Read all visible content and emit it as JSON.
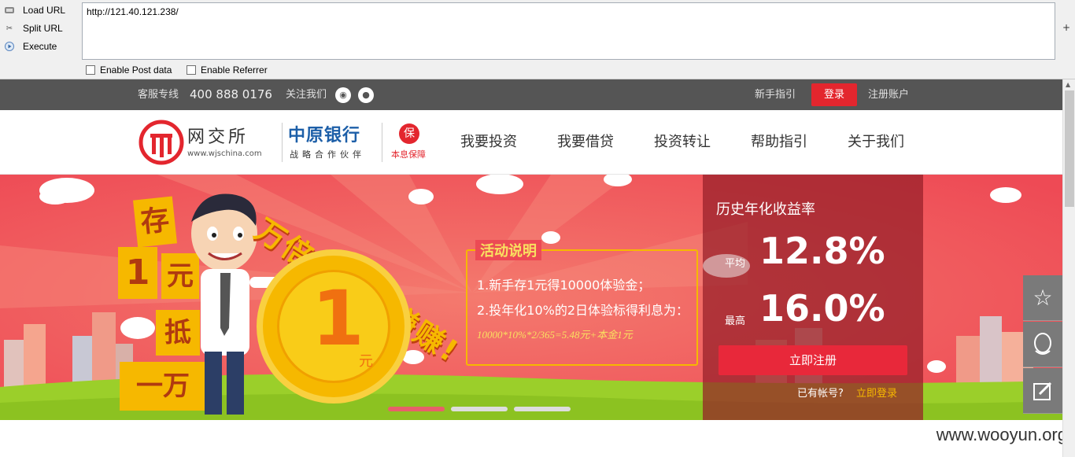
{
  "hackbar": {
    "load_url": "Load URL",
    "split_url": "Split URL",
    "execute": "Execute",
    "url_value": "http://121.40.121.238/",
    "enable_post": "Enable Post data",
    "enable_referrer": "Enable Referrer"
  },
  "topbar": {
    "service_label": "客服专线",
    "phone": "400 888 0176",
    "follow_label": "关注我们",
    "guide": "新手指引",
    "login": "登录",
    "register": "注册账户"
  },
  "nav": {
    "logo_name": "网交所",
    "logo_url": "www.wjschina.com",
    "partner_name": "中原银行",
    "partner_sub": "战略合作伙伴",
    "guarantee_badge": "保",
    "guarantee_text": "本息保障",
    "items": [
      "我要投资",
      "我要借贷",
      "投资转让",
      "帮助指引",
      "关于我们"
    ]
  },
  "banner": {
    "side_chars": [
      "存",
      "1",
      "元",
      "抵",
      "一万"
    ],
    "slogan": "万倍收益赚赚赚!",
    "coin_value": "1",
    "coin_unit": "元",
    "activity_title": "活动说明",
    "activity_line1": "1.新手存1元得10000体验金；",
    "activity_line2": "2.投年化10%的2日体验标得利息为：",
    "activity_formula": "10000*10%*2/365=5.48元+本金1元"
  },
  "panel": {
    "title": "历史年化收益率",
    "avg_label": "平均",
    "avg_value": "12.8%",
    "max_label": "最高",
    "max_value": "16.0%",
    "register_button": "立即注册",
    "have_account": "已有帐号?",
    "login_now": "立即登录"
  },
  "watermark": "www.wooyun.org",
  "colors": {
    "accent_red": "#e3262e",
    "banner_red": "#f05a5c",
    "gold": "#f6b800"
  }
}
